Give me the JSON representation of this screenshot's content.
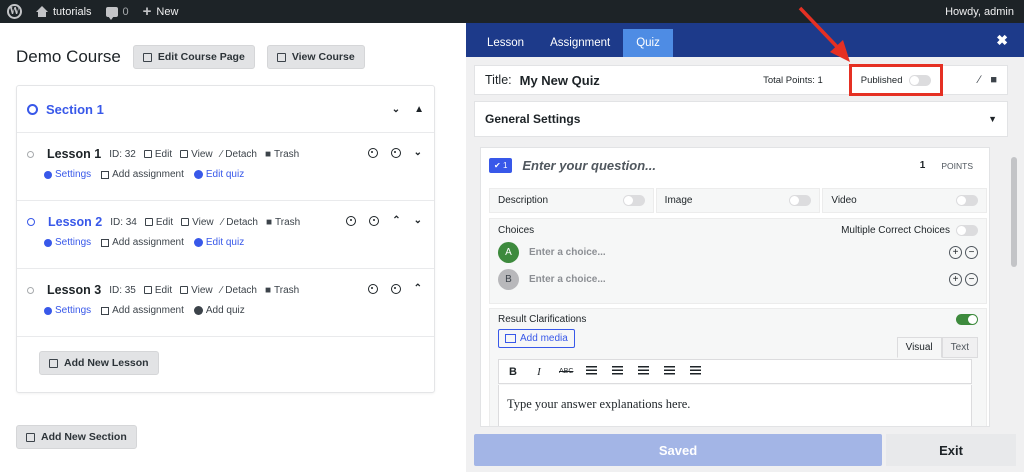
{
  "adminbar": {
    "site_name": "tutorials",
    "comments_count": "0",
    "new_label": "New",
    "howdy": "Howdy, admin"
  },
  "course": {
    "title": "Demo Course",
    "edit_page_label": "Edit Course Page",
    "view_course_label": "View Course",
    "section": {
      "title": "Section 1",
      "lessons": [
        {
          "name": "Lesson 1",
          "id": "ID: 32",
          "edit": "Edit",
          "view": "View",
          "detach": "Detach",
          "trash": "Trash",
          "settings": "Settings",
          "add_assignment": "Add assignment",
          "quiz": "Edit quiz"
        },
        {
          "name": "Lesson 2",
          "id": "ID: 34",
          "edit": "Edit",
          "view": "View",
          "detach": "Detach",
          "trash": "Trash",
          "settings": "Settings",
          "add_assignment": "Add assignment",
          "quiz": "Edit quiz"
        },
        {
          "name": "Lesson 3",
          "id": "ID: 35",
          "edit": "Edit",
          "view": "View",
          "detach": "Detach",
          "trash": "Trash",
          "settings": "Settings",
          "add_assignment": "Add assignment",
          "quiz": "Add quiz"
        }
      ]
    },
    "add_lesson_label": "Add New Lesson",
    "add_section_label": "Add New Section"
  },
  "panel": {
    "tabs": [
      "Lesson",
      "Assignment",
      "Quiz"
    ],
    "active_tab": "Quiz",
    "title_label": "Title:",
    "title_value": "My New Quiz",
    "total_points": "Total Points: 1",
    "published_label": "Published",
    "general_settings": "General Settings",
    "question": {
      "number": "1",
      "placeholder": "Enter your question...",
      "points": "1",
      "points_label": "POINTS"
    },
    "options": [
      "Description",
      "Image",
      "Video"
    ],
    "choices_label": "Choices",
    "multiple_label": "Multiple Correct Choices",
    "choices": [
      {
        "letter": "A",
        "placeholder": "Enter a choice..."
      },
      {
        "letter": "B",
        "placeholder": "Enter a choice..."
      }
    ],
    "result_label": "Result Clarifications",
    "add_media": "Add media",
    "visual_tab": "Visual",
    "text_tab": "Text",
    "editor_text": "Type your answer explanations here.",
    "saved_label": "Saved",
    "exit_label": "Exit"
  },
  "colors": {
    "accent": "#3858e9",
    "tab_bar": "#1d3a8a",
    "active_tab": "#4e8ce4",
    "highlight": "#e53023"
  }
}
